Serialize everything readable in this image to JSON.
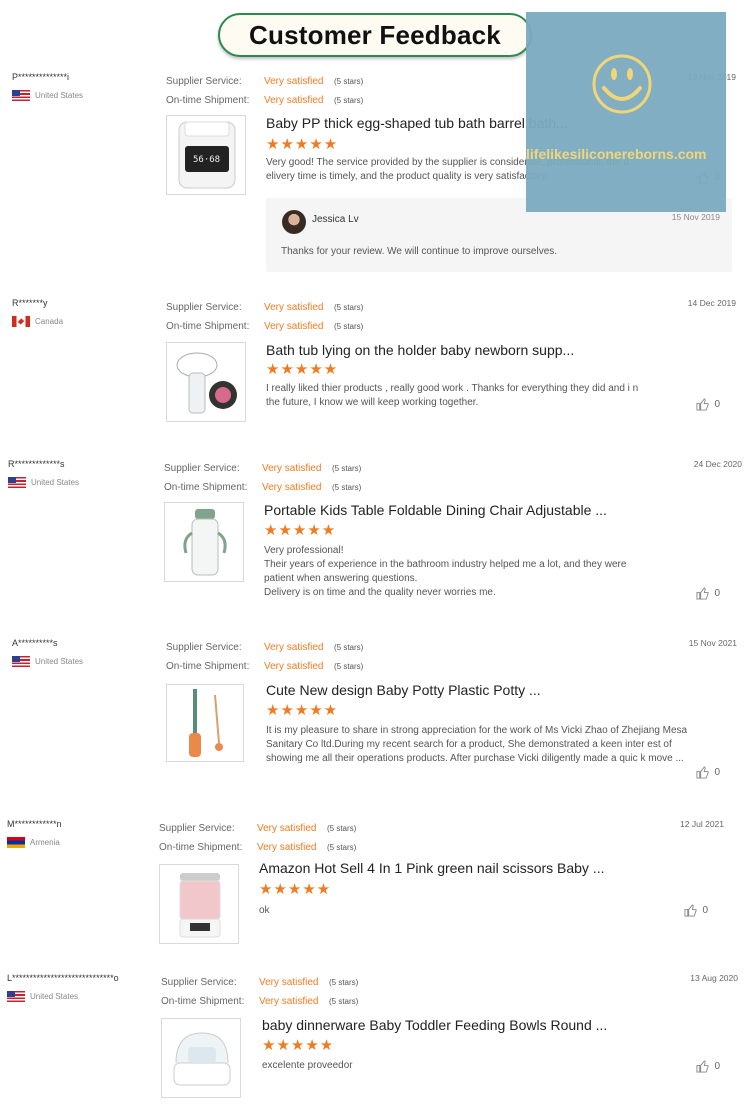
{
  "banner_title": "Customer Feedback",
  "watermark_text": "lifelikesiliconereborns.com",
  "labels": {
    "supplier_service": "Supplier Service:",
    "ontime_shipment": "On-time Shipment:"
  },
  "colors": {
    "accent": "#f07c22",
    "banner_border": "#2a8a4f",
    "watermark_bg": "#7aaac0"
  },
  "reviews": [
    {
      "reviewer": "P**************i",
      "country": "United States",
      "flag": "us",
      "supplier_rating": "Very satisfied",
      "supplier_stars": "(5 stars)",
      "shipment_rating": "Very satisfied",
      "shipment_stars": "(5 stars)",
      "date": "13 Nov 2019",
      "product_title": "Baby PP thick egg-shaped tub bath barrel bath...",
      "stars": "★★★★★",
      "rating": 5,
      "comment": "Very good! The service provided by the supplier is considerate, professional, the d elivery time is timely, and the product quality is very satisfactory.",
      "likes": "0",
      "reply": {
        "name": "Jessica Lv",
        "date": "15 Nov 2019",
        "text": "Thanks for your review. We will continue to improve ourselves."
      }
    },
    {
      "reviewer": "R*******y",
      "country": "Canada",
      "flag": "ca",
      "supplier_rating": "Very satisfied",
      "supplier_stars": "(5 stars)",
      "shipment_rating": "Very satisfied",
      "shipment_stars": "(5 stars)",
      "date": "14 Dec 2019",
      "product_title": "Bath tub lying on the holder baby newborn supp...",
      "stars": "★★★★★",
      "rating": 5,
      "comment": "I really liked thier products , really good work . Thanks for everything they did and i n the future, I know we will keep working together.",
      "likes": "0"
    },
    {
      "reviewer": "R*************s",
      "country": "United States",
      "flag": "us",
      "supplier_rating": "Very satisfied",
      "supplier_stars": "(5 stars)",
      "shipment_rating": "Very satisfied",
      "shipment_stars": "(5 stars)",
      "date": "24 Dec 2020",
      "product_title": "Portable Kids Table Foldable Dining Chair Adjustable ...",
      "stars": "★★★★★",
      "rating": 5,
      "comment": "Very professional!\nTheir years of experience in the bathroom industry helped me a lot, and they were patient when answering questions.\nDelivery is on time and the quality never worries me.",
      "likes": "0"
    },
    {
      "reviewer": "A**********s",
      "country": "United States",
      "flag": "us",
      "supplier_rating": "Very satisfied",
      "supplier_stars": "(5 stars)",
      "shipment_rating": "Very satisfied",
      "shipment_stars": "(5 stars)",
      "date": "15 Nov 2021",
      "product_title": "Cute New design Baby Potty Plastic Potty ...",
      "stars": "★★★★★",
      "rating": 5,
      "comment": "It is my pleasure to share in strong appreciation for the work of Ms Vicki Zhao of Zhejiang Mesa Sanitary Co ltd.During my recent search for a product, She demonstrated a keen inter est of showing me all their operations products. After purchase Vicki diligently made a quic k move ...",
      "likes": "0"
    },
    {
      "reviewer": "M************n",
      "country": "Armenia",
      "flag": "am",
      "supplier_rating": "Very satisfied",
      "supplier_stars": "(5 stars)",
      "shipment_rating": "Very satisfied",
      "shipment_stars": "(5 stars)",
      "date": "12 Jul 2021",
      "product_title": "Amazon Hot Sell 4 In 1 Pink green nail scissors Baby ...",
      "stars": "★★★★★",
      "rating": 5,
      "comment": "ok",
      "likes": "0"
    },
    {
      "reviewer": "L*****************************o",
      "country": "United States",
      "flag": "us",
      "supplier_rating": "Very satisfied",
      "supplier_stars": "(5 stars)",
      "shipment_rating": "Very satisfied",
      "shipment_stars": "(5 stars)",
      "date": "13 Aug 2020",
      "product_title": "baby dinnerware Baby Toddler Feeding Bowls Round ...",
      "stars": "★★★★★",
      "rating": 5,
      "comment": "excelente proveedor",
      "likes": "0"
    }
  ]
}
